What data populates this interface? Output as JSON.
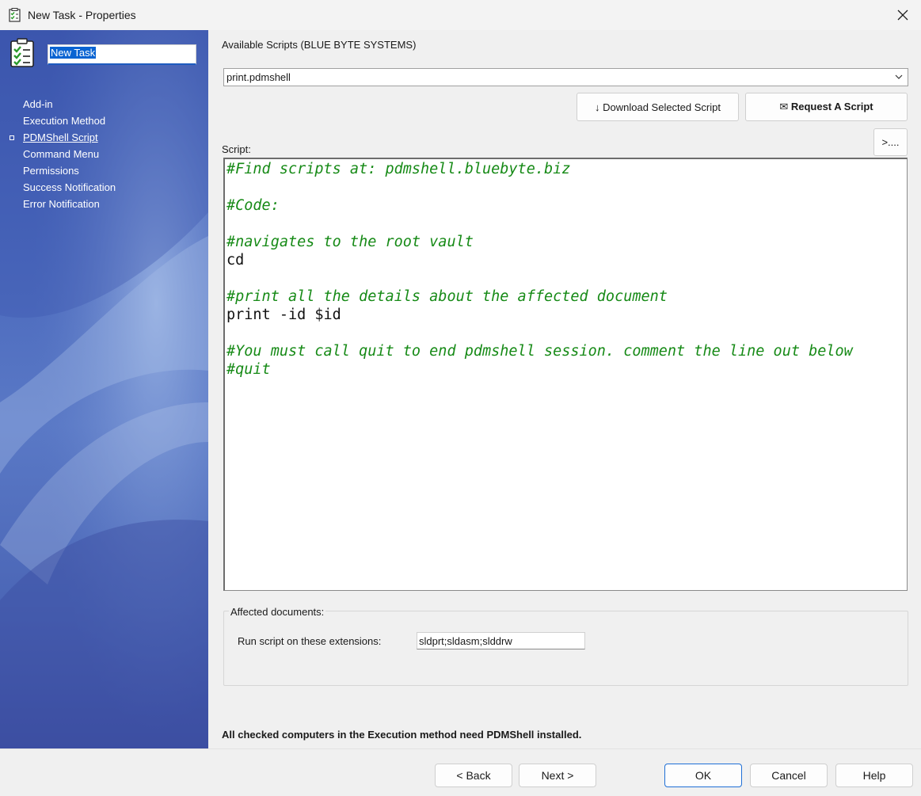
{
  "window": {
    "title": "New Task - Properties"
  },
  "sidebar": {
    "task_name": "New Task",
    "items": [
      {
        "label": "Add-in",
        "active": false
      },
      {
        "label": "Execution Method",
        "active": false
      },
      {
        "label": "PDMShell Script",
        "active": true
      },
      {
        "label": "Command Menu",
        "active": false
      },
      {
        "label": "Permissions",
        "active": false
      },
      {
        "label": "Success Notification",
        "active": false
      },
      {
        "label": "Error Notification",
        "active": false
      }
    ]
  },
  "main": {
    "available_scripts_label": "Available Scripts (BLUE BYTE SYSTEMS)",
    "selected_script": "print.pdmshell",
    "download_button": "↓ Download  Selected  Script",
    "request_button": "✉ Request A Script",
    "expand_button": ">....",
    "script_label": "Script:",
    "script_lines": [
      {
        "text": "#Find scripts at: pdmshell.bluebyte.biz",
        "type": "cmt"
      },
      {
        "text": "",
        "type": "code"
      },
      {
        "text": "#Code:",
        "type": "cmt"
      },
      {
        "text": "",
        "type": "code"
      },
      {
        "text": "#navigates to the root vault",
        "type": "cmt"
      },
      {
        "text": "cd",
        "type": "code"
      },
      {
        "text": "",
        "type": "code"
      },
      {
        "text": "#print all the details about the affected document",
        "type": "cmt"
      },
      {
        "text": "print -id $id",
        "type": "code"
      },
      {
        "text": "",
        "type": "code"
      },
      {
        "text": "#You must call quit to end pdmshell session. comment the line out below",
        "type": "cmt"
      },
      {
        "text": "#quit",
        "type": "cmt"
      }
    ],
    "affected_documents_label": "Affected documents:",
    "extensions_label": "Run script on these extensions:",
    "extensions_value": "sldprt;sldasm;slddrw",
    "note": "All checked computers in the Execution method need PDMShell installed."
  },
  "footer": {
    "back": "< Back",
    "next": "Next >",
    "ok": "OK",
    "cancel": "Cancel",
    "help": "Help"
  },
  "colors": {
    "sidebar": "#4a68bc",
    "comment": "#168a16",
    "accent": "#0a64d2"
  }
}
